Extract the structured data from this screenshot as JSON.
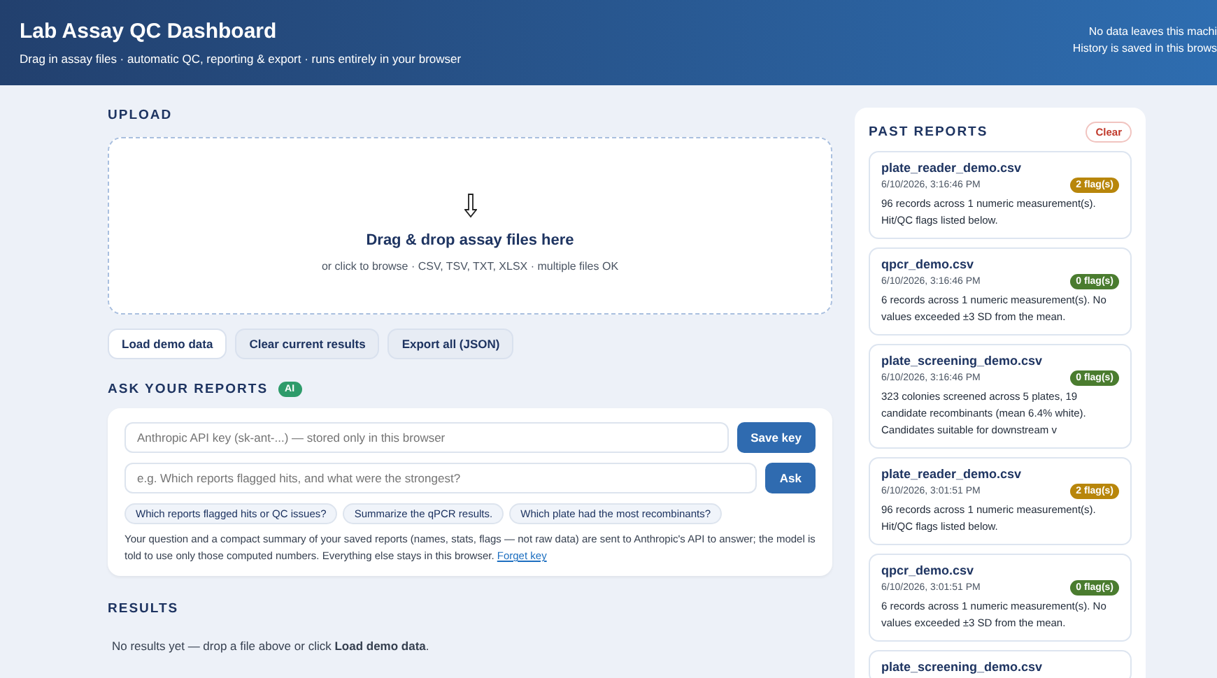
{
  "header": {
    "title": "Lab Assay QC Dashboard",
    "subtitle": "Drag in assay files · automatic QC, reporting & export · runs entirely in your browser",
    "notes": [
      "No data leaves this machi",
      "History is saved in this brows"
    ]
  },
  "upload": {
    "heading": "UPLOAD",
    "drop_title": "Drag & drop assay files here",
    "drop_hint": "or click to browse · CSV, TSV, TXT, XLSX · multiple files OK",
    "buttons": [
      {
        "label": "Load demo data",
        "primary": true
      },
      {
        "label": "Clear current results",
        "primary": false
      },
      {
        "label": "Export all (JSON)",
        "primary": false
      }
    ]
  },
  "ask": {
    "heading": "ASK YOUR REPORTS",
    "badge": "AI",
    "key_field": {
      "placeholder": "Anthropic API key (sk-ant-...) — stored only in this browser"
    },
    "key_button": "Save key",
    "question_field": {
      "placeholder": "e.g. Which reports flagged hits, and what were the strongest?"
    },
    "ask_button": "Ask",
    "suggestions": [
      "Which reports flagged hits or QC issues?",
      "Summarize the qPCR results.",
      "Which plate had the most recombinants?"
    ],
    "note": "Your question and a compact summary of your saved reports (names, stats, flags — not raw data) are sent to Anthropic's API to answer; the model is told to use only those computed numbers. Everything else stays in this browser.",
    "note_link": "Forget key"
  },
  "results": {
    "heading": "RESULTS",
    "empty": "No results yet — drop a file above or click **Load demo data**."
  },
  "past_reports": {
    "heading": "PAST REPORTS",
    "clear_button": "Clear",
    "items": [
      {
        "name": "plate_reader_demo.csv",
        "time": "6/10/2026, 3:16:46 PM",
        "flags": "2 flag(s)",
        "color": "#b8860b",
        "summary": "96 records across 1 numeric measurement(s). Hit/QC flags listed below."
      },
      {
        "name": "qpcr_demo.csv",
        "time": "6/10/2026, 3:16:46 PM",
        "flags": "0 flag(s)",
        "color": "#4a7c2f",
        "summary": "6 records across 1 numeric measurement(s). No values exceeded ±3 SD from the mean."
      },
      {
        "name": "plate_screening_demo.csv",
        "time": "6/10/2026, 3:16:46 PM",
        "flags": "0 flag(s)",
        "color": "#4a7c2f",
        "summary": "323 colonies screened across 5 plates, 19 candidate recombinants (mean 6.4% white). Candidates suitable for downstream v"
      },
      {
        "name": "plate_reader_demo.csv",
        "time": "6/10/2026, 3:01:51 PM",
        "flags": "2 flag(s)",
        "color": "#b8860b",
        "summary": "96 records across 1 numeric measurement(s). Hit/QC flags listed below."
      },
      {
        "name": "qpcr_demo.csv",
        "time": "6/10/2026, 3:01:51 PM",
        "flags": "0 flag(s)",
        "color": "#4a7c2f",
        "summary": "6 records across 1 numeric measurement(s). No values exceeded ±3 SD from the mean."
      },
      {
        "name": "plate_screening_demo.csv"
      }
    ]
  }
}
